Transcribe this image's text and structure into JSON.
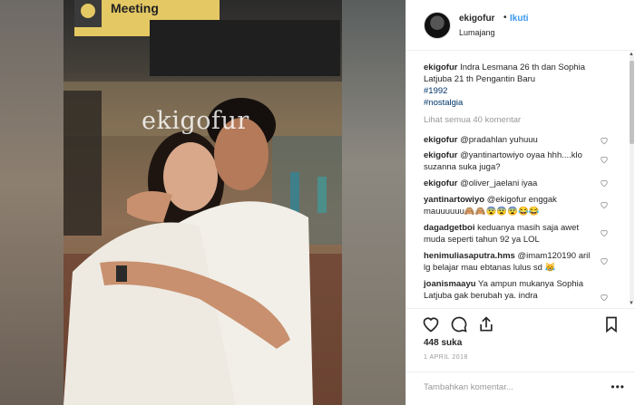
{
  "post": {
    "owner": "ekigofur",
    "separator": "•",
    "follow_label": "Ikuti",
    "location": "Lumajang",
    "photo_watermark": "ekigofur",
    "photo_sign": "Meeting"
  },
  "caption": {
    "user": "ekigofur",
    "text": "Indra Lesmana 26 th dan Sophia Latjuba 21 th Pengantin Baru",
    "tags": [
      "#1992",
      "#nostalgia"
    ]
  },
  "view_all": "Lihat semua 40 komentar",
  "comments": [
    {
      "user": "ekigofur",
      "text": "@pradahlan yuhuuu"
    },
    {
      "user": "ekigofur",
      "text": "@yantinartowiyo oyaa hhh....klo suzanna suka juga?"
    },
    {
      "user": "ekigofur",
      "text": "@oliver_jaelani iyaa"
    },
    {
      "user": "yantinartowiyo",
      "text": "@ekigofur enggak mauuuuuu🙈🙈😨😨😨😂😂"
    },
    {
      "user": "dagadgetboi",
      "text": "keduanya masih saja awet muda seperti tahun 92 ya LOL"
    },
    {
      "user": "henimuliasaputra.hms",
      "text": "@imam120190 aril lg belajar mau ebtanas lulus sd 😹"
    },
    {
      "user": "joanismaayu",
      "text": "Ya ampun mukanya Sophia Latjuba gak berubah ya. indra"
    }
  ],
  "likes": "448 suka",
  "date": "1 APRIL 2018",
  "add_comment_placeholder": "Tambahkan komentar...",
  "more_icon": "ellipsis-icon",
  "colors": {
    "link": "#3897f0",
    "hashtag": "#003569",
    "muted": "#999999"
  }
}
